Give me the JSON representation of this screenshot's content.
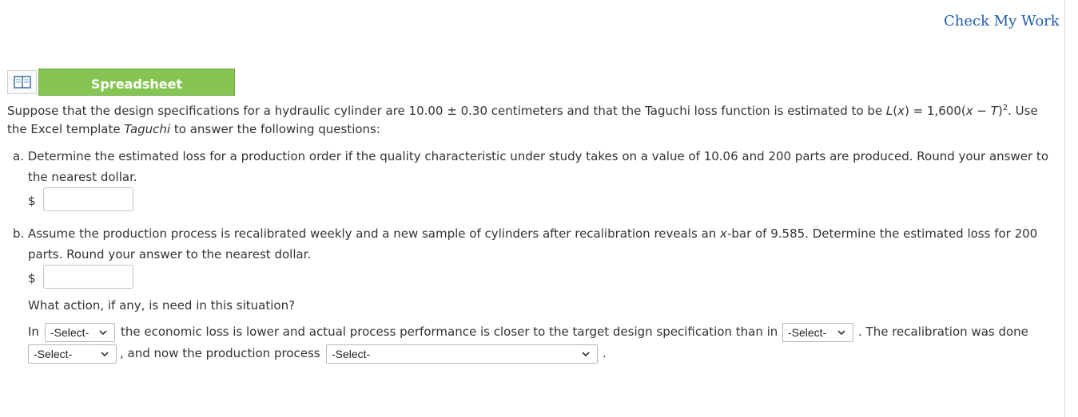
{
  "header": {
    "check_link": "Check My Work"
  },
  "spreadsheet": {
    "label": "Spreadsheet"
  },
  "intro": {
    "l1_a": "Suppose that the design specifications for a hydraulic cylinder are 10.00 ± 0.30 centimeters and that the Taguchi loss function is estimated to be ",
    "l1_fn": "L",
    "l1_b": "(",
    "l1_x": "x",
    "l1_c": ") = 1,600(",
    "l1_x2": "x",
    "l1_d": " − ",
    "l1_T": "T",
    "l1_e": ")",
    "l1_sup": "2",
    "l1_f": ". Use",
    "l2_a": "the Excel template ",
    "l2_template": "Taguchi",
    "l2_b": " to answer the following questions:"
  },
  "part_a": {
    "line1": "a. Determine the estimated loss for a production order if the quality characteristic under study takes on a value of 10.06 and 200 parts are produced. Round your answer to",
    "line2": "the nearest dollar.",
    "currency": "$",
    "value": ""
  },
  "part_b": {
    "line1_a": "b. Assume the production process is recalibrated weekly and a new sample of cylinders after recalibration reveals an ",
    "line1_x": "x",
    "line1_b": "-bar of 9.585. Determine the estimated loss for 200",
    "line2": "parts. Round your answer to the nearest dollar.",
    "currency": "$",
    "value": ""
  },
  "action": {
    "question": "What action, if any, is need in this situation?",
    "t_in": "In",
    "select1": "-Select-",
    "t_mid": "the economic loss is lower and actual process performance is closer to the target design specification than in",
    "select2": "-Select-",
    "t_after": ". The recalibration was done",
    "select3": "-Select-",
    "t_and": ", and now the production process",
    "select4": "-Select-",
    "t_end": "."
  }
}
